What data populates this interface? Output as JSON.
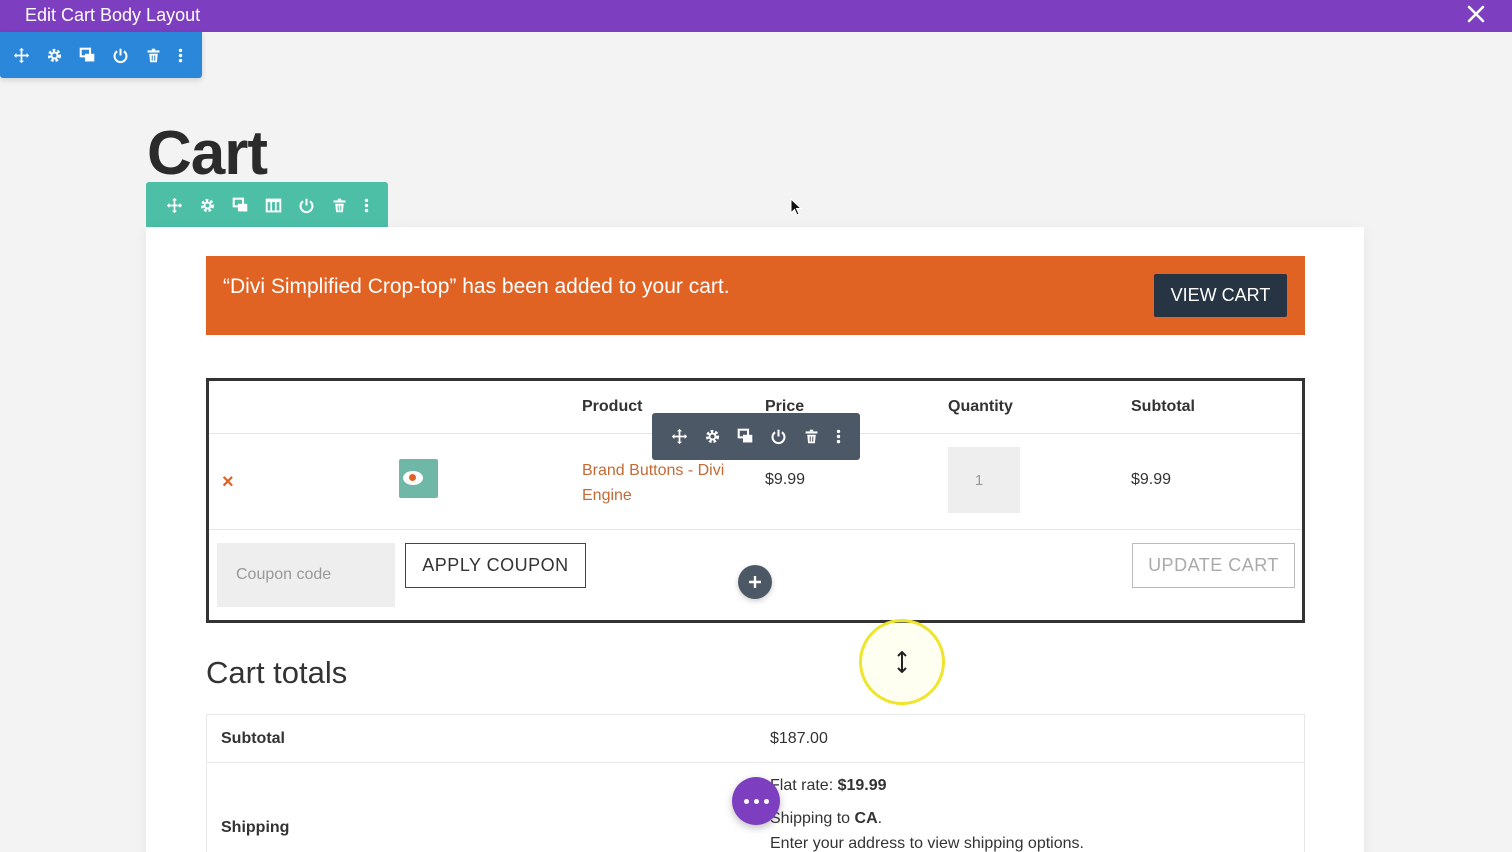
{
  "window": {
    "title": "Edit Cart Body Layout"
  },
  "colors": {
    "builder_purple": "#7d3fbf",
    "section_blue": "#2b87da",
    "row_teal": "#4cbfa6",
    "module_dark": "#4c5866",
    "notice_orange": "#e06323",
    "view_cart_navy": "#263443"
  },
  "toolbars": {
    "section": [
      "move-icon",
      "settings-icon",
      "duplicate-icon",
      "power-icon",
      "trash-icon",
      "more-icon"
    ],
    "row": [
      "move-icon",
      "settings-icon",
      "duplicate-icon",
      "columns-icon",
      "power-icon",
      "trash-icon",
      "more-icon"
    ],
    "module": [
      "move-icon",
      "settings-icon",
      "duplicate-icon",
      "power-icon",
      "trash-icon",
      "more-icon"
    ]
  },
  "page": {
    "title": "Cart"
  },
  "notice": {
    "message": "“Divi Simplified Crop-top” has been added to your cart.",
    "button": "VIEW CART"
  },
  "cart_table": {
    "headers": {
      "product": "Product",
      "price": "Price",
      "quantity": "Quantity",
      "subtotal": "Subtotal"
    },
    "items": [
      {
        "remove": "×",
        "product": "Brand Buttons - Divi Engine",
        "price": "$9.99",
        "quantity": "1",
        "subtotal": "$9.99"
      }
    ],
    "coupon_placeholder": "Coupon code",
    "apply_coupon": "APPLY COUPON",
    "update_cart": "UPDATE CART"
  },
  "totals": {
    "title": "Cart totals",
    "subtotal_label": "Subtotal",
    "subtotal_value": "$187.00",
    "shipping_label": "Shipping",
    "flat_rate_prefix": "Flat rate: ",
    "flat_rate_value": "$19.99",
    "shipping_to_prefix": "Shipping to ",
    "shipping_to_value": "CA",
    "shipping_to_suffix": ".",
    "address_note": "Enter your address to view shipping options."
  }
}
